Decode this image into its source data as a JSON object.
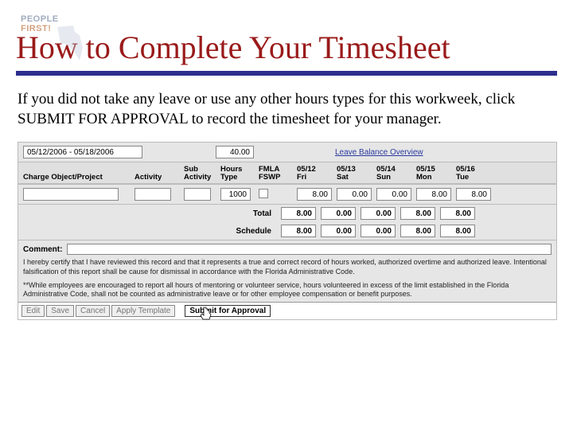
{
  "watermark": {
    "people": "PEOPLE",
    "first": "FIRST!"
  },
  "title": "How to Complete Your Timesheet",
  "instruction": "If you did not take any leave or use any other hours types for this workweek, click SUBMIT FOR APPROVAL to record the timesheet for your manager.",
  "top": {
    "period": "05/12/2006 - 05/18/2006",
    "total_hours": "40.00",
    "leave_link": "Leave Balance Overview"
  },
  "headers": {
    "charge": "Charge Object/Project",
    "activity": "Activity",
    "sub_activity": "Sub Activity",
    "hours_type": "Hours Type",
    "fmla": "FMLA FSWP",
    "days": [
      {
        "date": "05/12",
        "dow": "Fri"
      },
      {
        "date": "05/13",
        "dow": "Sat"
      },
      {
        "date": "05/14",
        "dow": "Sun"
      },
      {
        "date": "05/15",
        "dow": "Mon"
      },
      {
        "date": "05/16",
        "dow": "Tue"
      }
    ]
  },
  "row1": {
    "hours_type": "1000",
    "values": [
      "8.00",
      "0.00",
      "0.00",
      "8.00",
      "8.00"
    ]
  },
  "totals": {
    "label_total": "Total",
    "label_schedule": "Schedule",
    "total": [
      "8.00",
      "0.00",
      "0.00",
      "8.00",
      "8.00"
    ],
    "schedule": [
      "8.00",
      "0.00",
      "0.00",
      "8.00",
      "8.00"
    ]
  },
  "comment_label": "Comment:",
  "cert1": "I hereby certify that I have reviewed this record and that it represents a true and correct record of hours worked, authorized overtime and authorized leave. Intentional falsification of this report shall be cause for dismissal in accordance with the Florida Administrative Code.",
  "cert2": "**While employees are encouraged to report all hours of mentoring or volunteer service, hours volunteered in excess of the limit established in the Florida Administrative Code, shall not be counted as administrative leave or for other employee compensation or benefit purposes.",
  "buttons": {
    "edit": "Edit",
    "save": "Save",
    "cancel": "Cancel",
    "apply_template": "Apply Template",
    "submit": "Submit for Approval"
  }
}
